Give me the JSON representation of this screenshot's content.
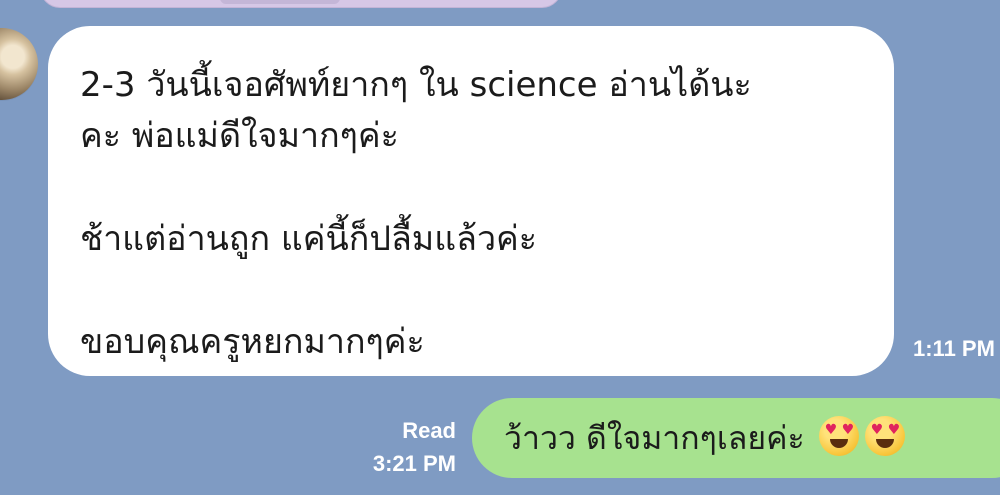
{
  "chat": {
    "incoming": {
      "lines": [
        "2-3 วันนี้เจอศัพท์ยากๆ ใน science อ่านได้นะ",
        "คะ พ่อแม่ดีใจมากๆค่ะ",
        "ช้าแต่อ่านถูก แค่นี้ก็ปลื้มแล้วค่ะ",
        "ขอบคุณครูหยกมากๆค่ะ"
      ],
      "time": "1:11 PM"
    },
    "outgoing": {
      "status": "Read",
      "time": "3:21 PM",
      "text": "ว้าวว ดีใจมากๆเลยค่ะ",
      "emoji": "smiling-face-with-heart-eyes"
    }
  },
  "colors": {
    "background": "#7f9bc3",
    "incoming_bubble": "#ffffff",
    "outgoing_bubble": "#a7e28f",
    "meta_text": "#ffffff"
  }
}
